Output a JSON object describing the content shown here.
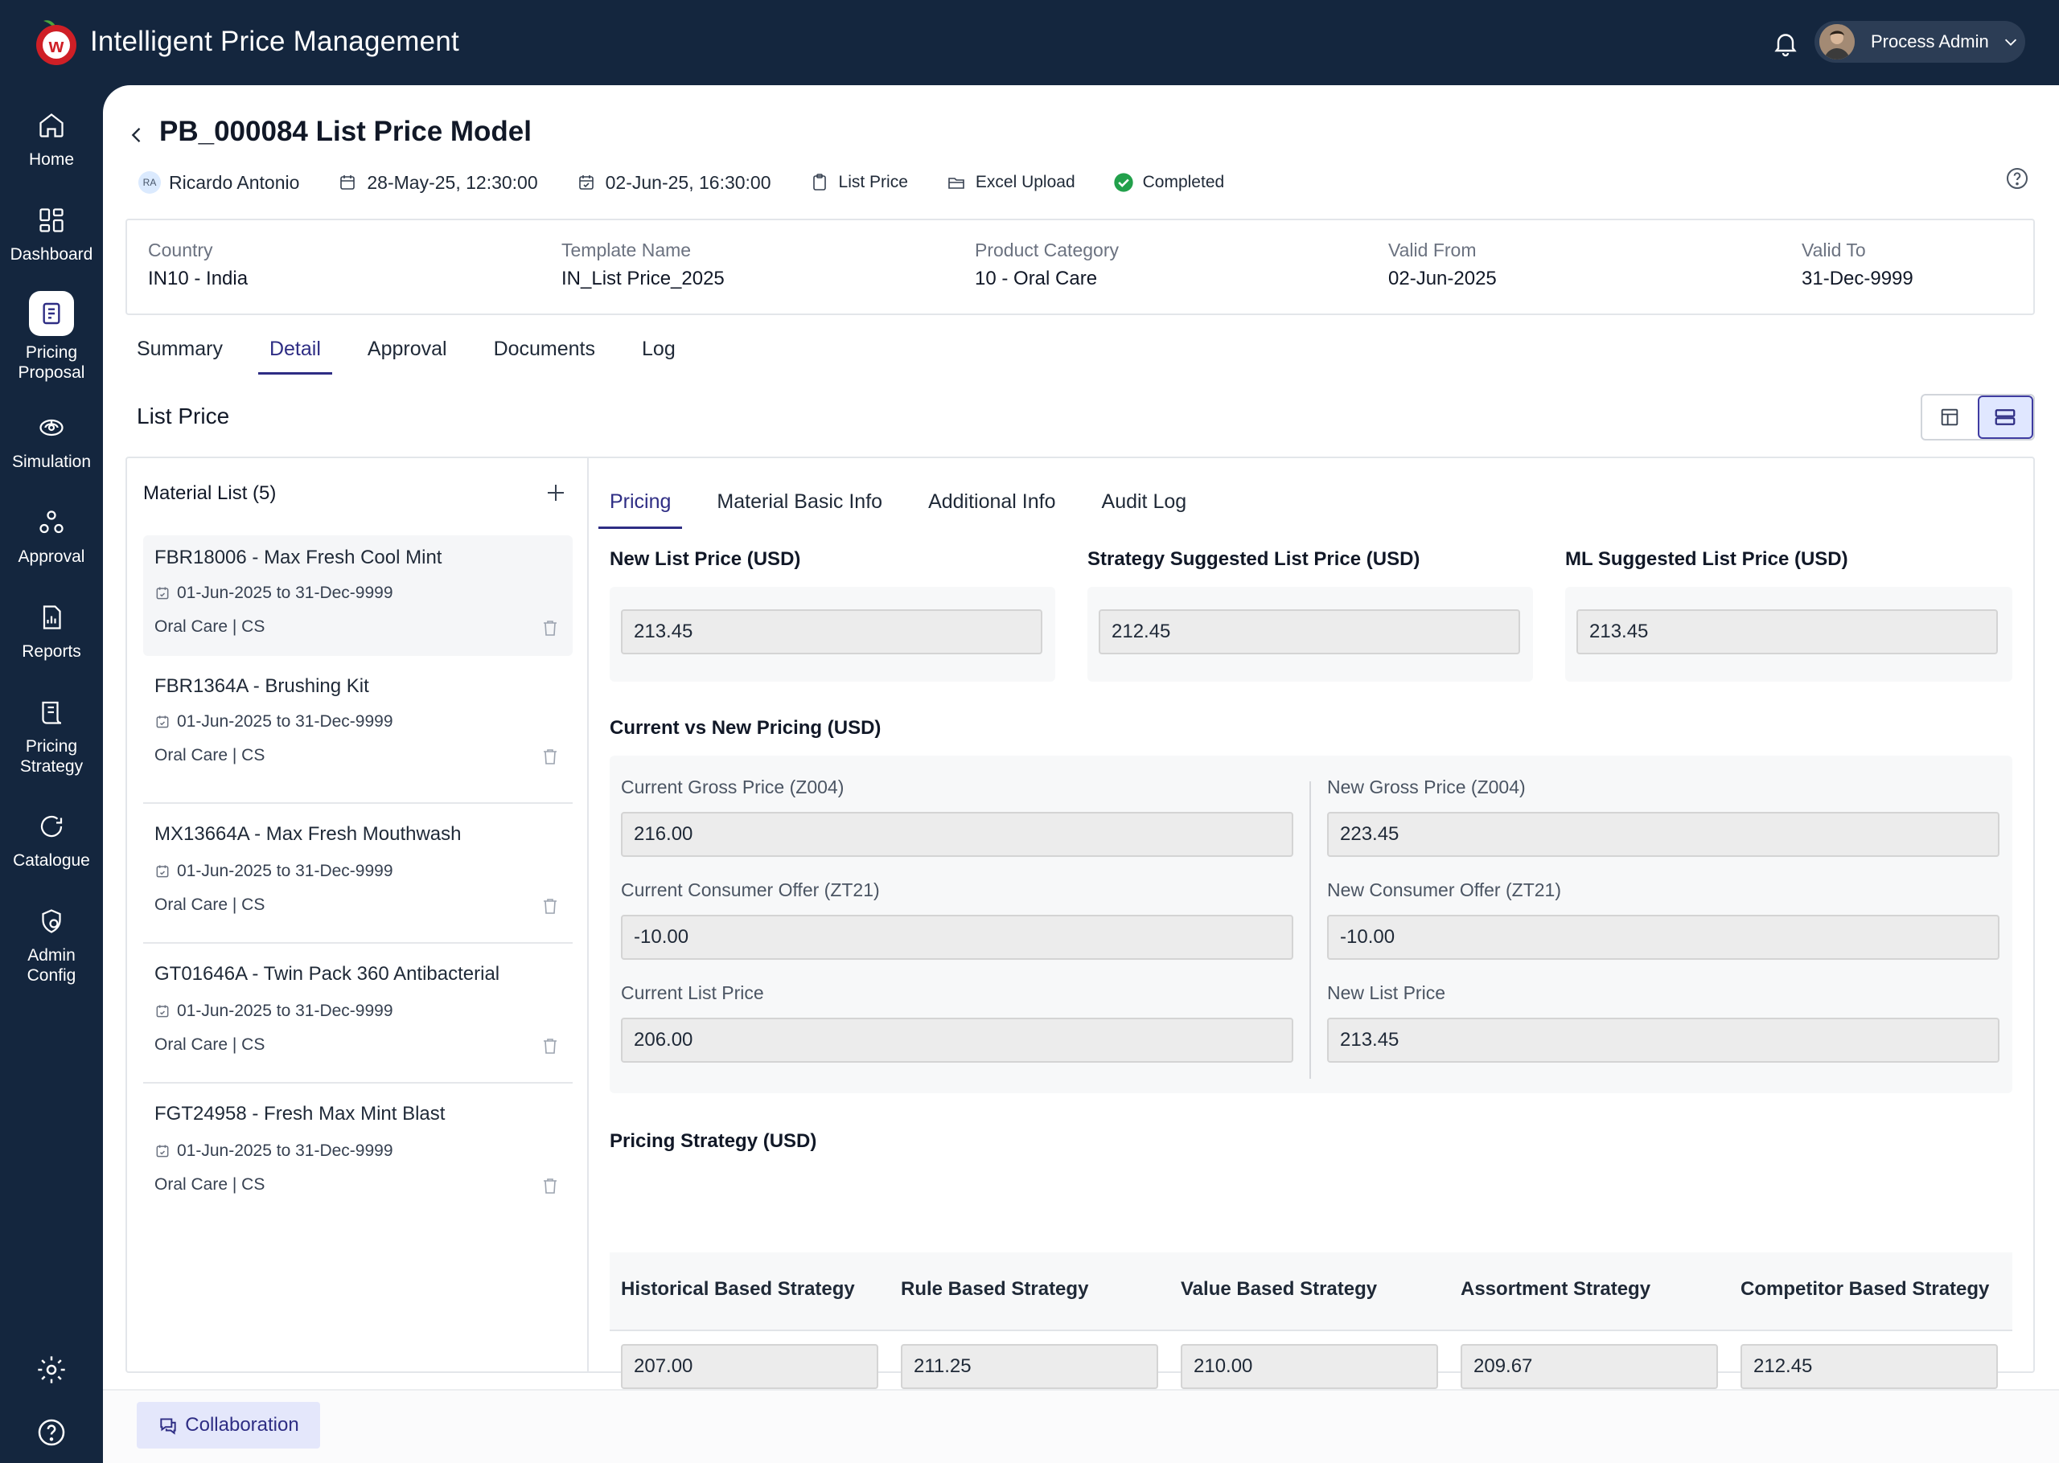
{
  "app": {
    "title": "Intelligent Price Management",
    "logo_letter": "w",
    "brand_color": "#cf1f26",
    "accent_color": "#2e2d84",
    "nav_color": "#14263e"
  },
  "user": {
    "name": "Process Admin"
  },
  "sidebar": {
    "items": [
      {
        "label": "Home",
        "icon": "home-icon"
      },
      {
        "label": "Dashboard",
        "icon": "dashboard-icon"
      },
      {
        "label": "Pricing Proposal",
        "icon": "pricing-proposal-icon",
        "active": true
      },
      {
        "label": "Simulation",
        "icon": "simulation-icon"
      },
      {
        "label": "Approval",
        "icon": "approval-icon"
      },
      {
        "label": "Reports",
        "icon": "reports-icon"
      },
      {
        "label": "Pricing Strategy",
        "icon": "pricing-strategy-icon"
      },
      {
        "label": "Catalogue",
        "icon": "catalogue-icon"
      },
      {
        "label": "Admin Config",
        "icon": "admin-config-icon"
      }
    ]
  },
  "page": {
    "title": "PB_000084 List Price Model",
    "meta": {
      "owner_initials": "RA",
      "owner": "Ricardo Antonio",
      "created": "28-May-25, 12:30:00",
      "due": "02-Jun-25, 16:30:00",
      "type": "List Price",
      "source": "Excel Upload",
      "status": "Completed"
    }
  },
  "info": {
    "country": {
      "label": "Country",
      "value": "IN10 - India"
    },
    "template": {
      "label": "Template Name",
      "value": "IN_List Price_2025"
    },
    "category": {
      "label": "Product Category",
      "value": "10 - Oral Care"
    },
    "valid_from": {
      "label": "Valid From",
      "value": "02-Jun-2025"
    },
    "valid_to": {
      "label": "Valid To",
      "value": "31-Dec-9999"
    }
  },
  "tabs": [
    "Summary",
    "Detail",
    "Approval",
    "Documents",
    "Log"
  ],
  "section_title": "List Price",
  "material_list": {
    "header": "Material List (5)",
    "items": [
      {
        "title": "FBR18006 - Max Fresh Cool Mint",
        "dates": "01-Jun-2025 to 31-Dec-9999",
        "category": "Oral Care | CS"
      },
      {
        "title": "FBR1364A - Brushing Kit",
        "dates": "01-Jun-2025 to 31-Dec-9999",
        "category": "Oral Care | CS"
      },
      {
        "title": "MX13664A - Max Fresh Mouthwash",
        "dates": "01-Jun-2025 to 31-Dec-9999",
        "category": "Oral Care | CS"
      },
      {
        "title": "GT01646A - Twin Pack 360 Antibacterial",
        "dates": "01-Jun-2025 to 31-Dec-9999",
        "category": "Oral Care | CS"
      },
      {
        "title": "FGT24958 - Fresh Max Mint Blast",
        "dates": "01-Jun-2025 to 31-Dec-9999",
        "category": "Oral Care | CS"
      }
    ]
  },
  "subtabs": [
    "Pricing",
    "Material Basic Info",
    "Additional Info",
    "Audit Log"
  ],
  "pricing": {
    "new_list_price": {
      "label": "New List Price (USD)",
      "value": "213.45"
    },
    "strategy_suggested": {
      "label": "Strategy Suggested List Price (USD)",
      "value": "212.45"
    },
    "ml_suggested": {
      "label": "ML Suggested List Price (USD)",
      "value": "213.45"
    }
  },
  "current_vs_new": {
    "title": "Current vs New Pricing (USD)",
    "current_gross": {
      "label": "Current Gross Price (Z004)",
      "value": "216.00"
    },
    "current_offer": {
      "label": "Current Consumer Offer (ZT21)",
      "value": "-10.00"
    },
    "current_list": {
      "label": "Current List Price",
      "value": "206.00"
    },
    "new_gross": {
      "label": "New Gross Price (Z004)",
      "value": "223.45"
    },
    "new_offer": {
      "label": "New Consumer Offer (ZT21)",
      "value": "-10.00"
    },
    "new_list": {
      "label": "New List Price",
      "value": "213.45"
    }
  },
  "strategy": {
    "title": "Pricing Strategy (USD)",
    "columns": [
      "Historical Based Strategy",
      "Rule Based Strategy",
      "Value Based Strategy",
      "Assortment Strategy",
      "Competitor Based Strategy"
    ],
    "values": [
      "207.00",
      "211.25",
      "210.00",
      "209.67",
      "212.45"
    ]
  },
  "footer": {
    "collaboration": "Collaboration"
  }
}
